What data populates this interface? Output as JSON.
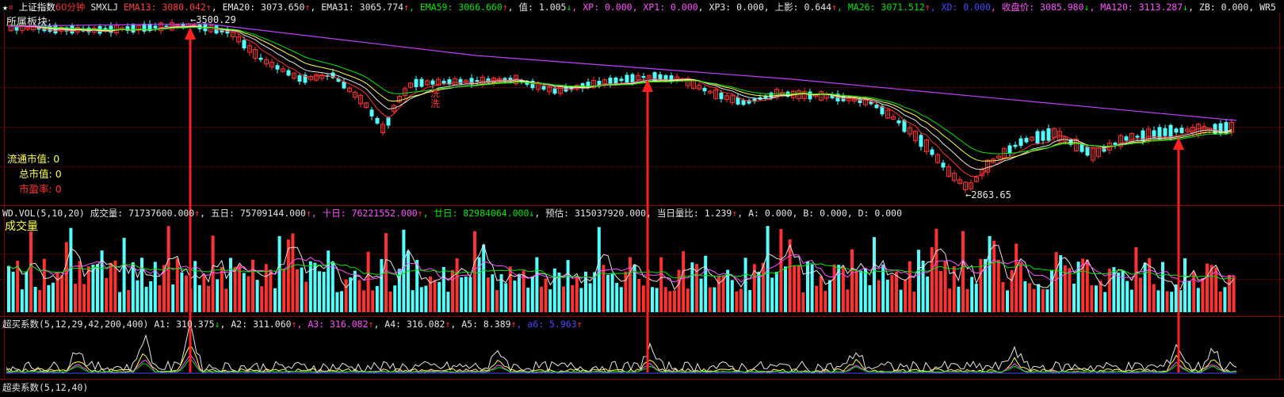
{
  "header": {
    "star": "★",
    "index_name": "上证指数",
    "period": "60分钟",
    "formula": "SMXLJ",
    "items": [
      {
        "label": "EMA13:",
        "value": "3080.042",
        "arrow": "↑",
        "color": "#ff4040"
      },
      {
        "label": "EMA20:",
        "value": "3073.650",
        "arrow": "↑",
        "color": "#e6e6e6"
      },
      {
        "label": "EMA31:",
        "value": "3065.774",
        "arrow": "↑",
        "color": "#e6e6e6"
      },
      {
        "label": "EMA59:",
        "value": "3066.660",
        "arrow": "↑",
        "color": "#00e600"
      },
      {
        "label": "值:",
        "value": "1.005",
        "arrow": "↓",
        "color": "#e6e6e6"
      },
      {
        "label": "XP:",
        "value": "0.000",
        "arrow": "",
        "color": "#ff54ff"
      },
      {
        "label": "XP1:",
        "value": "0.000",
        "arrow": "",
        "color": "#ff54ff"
      },
      {
        "label": "XP3:",
        "value": "0.000",
        "arrow": "",
        "color": "#e6e6e6"
      },
      {
        "label": "上影:",
        "value": "0.644",
        "arrow": "↑",
        "color": "#e6e6e6"
      },
      {
        "label": "MA26:",
        "value": "3071.512",
        "arrow": "↑",
        "color": "#00e600"
      },
      {
        "label": "XD:",
        "value": "0.000",
        "arrow": "",
        "color": "#4848ff"
      },
      {
        "label": "收盘价:",
        "value": "3085.980",
        "arrow": "↓",
        "color": "#ff54ff"
      },
      {
        "label": "MA120:",
        "value": "3113.287",
        "arrow": "↓",
        "color": "#ff54ff"
      },
      {
        "label": "ZB:",
        "value": "0.000",
        "arrow": "",
        "color": "#e6e6e6"
      },
      {
        "label": "WR5",
        "value": "",
        "arrow": "",
        "color": "#e6e6e6"
      }
    ]
  },
  "sector_label": "所属板块:",
  "high_label": "3500.29",
  "low_label": "2863.65",
  "wash_label_1": "洗",
  "wash_label_2": "洗",
  "side_info": {
    "circ_label": "流通市值:",
    "circ_value": "0",
    "total_label": "总市值:",
    "total_value": "0",
    "pe_label": "市盈率:",
    "pe_value": "0"
  },
  "volume": {
    "header_prefix": "WD.VOL(5,10,20)",
    "items": [
      {
        "label": "成交量:",
        "value": "71737600.000",
        "arrow": "↑",
        "color": "#e6e6e6"
      },
      {
        "label": "五日:",
        "value": "75709144.000",
        "arrow": "↑",
        "color": "#e6e6e6"
      },
      {
        "label": "十日:",
        "value": "76221552.000",
        "arrow": "↑",
        "color": "#ff54ff"
      },
      {
        "label": "廿日:",
        "value": "82984064.000",
        "arrow": "↓",
        "color": "#00e600"
      },
      {
        "label": "预估:",
        "value": "315037920.000",
        "arrow": "",
        "color": "#e6e6e6"
      },
      {
        "label": "当日量比:",
        "value": "1.239",
        "arrow": "↑",
        "color": "#e6e6e6"
      },
      {
        "label": "A:",
        "value": "0.000",
        "arrow": "",
        "color": "#e6e6e6"
      },
      {
        "label": "B:",
        "value": "0.000",
        "arrow": "",
        "color": "#e6e6e6"
      },
      {
        "label": "D:",
        "value": "0.000",
        "arrow": "",
        "color": "#e6e6e6"
      }
    ],
    "title": "成交量"
  },
  "oscillator": {
    "header_prefix": "超买系数(5,12,29,42,200,400)",
    "items": [
      {
        "label": "A1:",
        "value": "310.375",
        "arrow": "↓",
        "color": "#e6e6e6"
      },
      {
        "label": "A2:",
        "value": "311.060",
        "arrow": "↑",
        "color": "#e6e6e6"
      },
      {
        "label": "A3:",
        "value": "316.082",
        "arrow": "↑",
        "color": "#ff54ff"
      },
      {
        "label": "A4:",
        "value": "316.082",
        "arrow": "↑",
        "color": "#e6e6e6"
      },
      {
        "label": "A5:",
        "value": "8.389",
        "arrow": "↑",
        "color": "#e6e6e6"
      },
      {
        "label": "a6:",
        "value": "5.963",
        "arrow": "↑",
        "color": "#4848ff"
      }
    ]
  },
  "bottom_cut_label": "超卖系数(5,12,40)",
  "colors": {
    "up": "#ff3232",
    "down": "#54ffff",
    "ema13": "#ff3232",
    "ema20": "#e6e6e6",
    "ema59": "#00e600",
    "ma120": "#c040ff",
    "arrow": "#ff2020",
    "sep": "#8a0000"
  }
}
